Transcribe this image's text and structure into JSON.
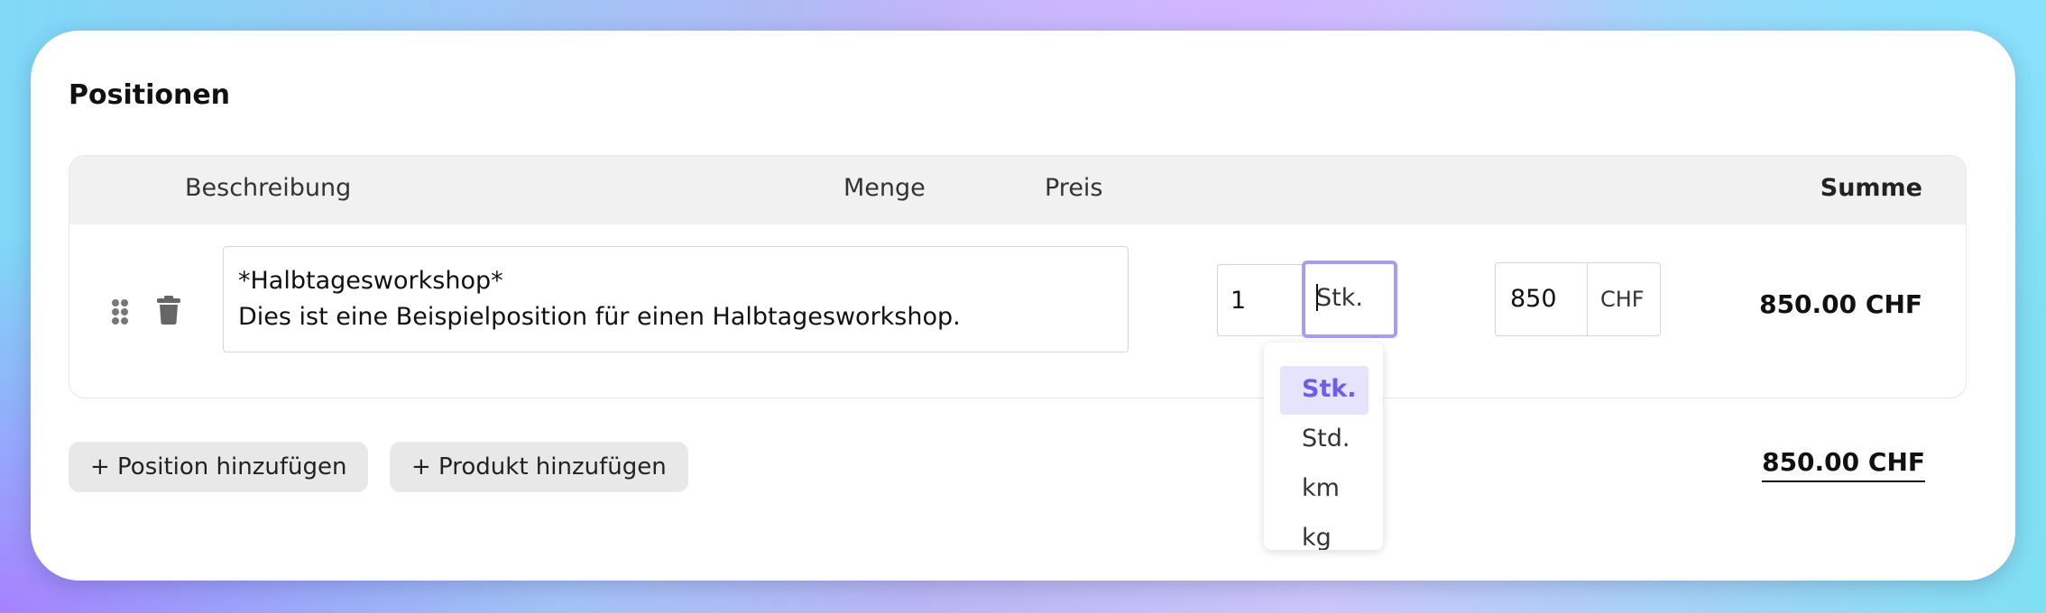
{
  "section": {
    "title": "Positionen"
  },
  "table": {
    "headers": {
      "description": "Beschreibung",
      "quantity": "Menge",
      "price": "Preis",
      "sum": "Summe"
    },
    "rows": [
      {
        "description_line1": "*Halbtagesworkshop*",
        "description_line2": "Dies ist eine Beispielposition für einen Halbtagesworkshop.",
        "quantity": "1",
        "unit": "Stk.",
        "price": "850",
        "currency": "CHF",
        "line_total": "850.00 CHF"
      }
    ]
  },
  "unit_dropdown": {
    "options": [
      "Stk.",
      "Std.",
      "km",
      "kg"
    ],
    "selected": "Stk."
  },
  "actions": {
    "add_position": "+ Position hinzufügen",
    "add_product": "+ Produkt hinzufügen"
  },
  "total": "850.00 CHF",
  "colors": {
    "accent": "#6a5ef0",
    "focus_border": "#a79df0",
    "selected_bg": "#e6e3fc"
  },
  "icons": [
    "drag-handle-icon",
    "trash-icon"
  ]
}
